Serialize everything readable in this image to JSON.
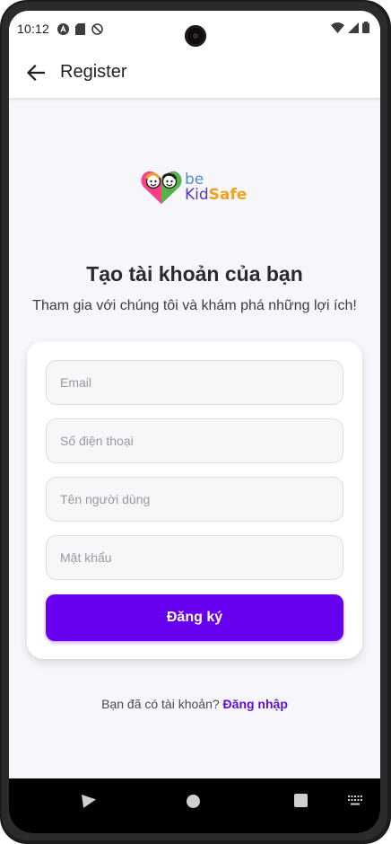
{
  "status_bar": {
    "time": "10:12",
    "left_icons": [
      "a-circle-icon",
      "sd-card-icon",
      "do-not-disturb-icon"
    ],
    "right_icons": [
      "wifi-icon",
      "signal-icon",
      "battery-icon"
    ]
  },
  "app_bar": {
    "title": "Register",
    "back_icon": "arrow-left-icon"
  },
  "logo": {
    "be": "be",
    "kid": "Kid",
    "safe": "Safe"
  },
  "heading": {
    "title": "Tạo tài khoản của bạn",
    "subtitle": "Tham gia với chúng tôi và khám phá những lợi ích!"
  },
  "form": {
    "email_placeholder": "Email",
    "phone_placeholder": "Số điện thoại",
    "username_placeholder": "Tên người dùng",
    "password_placeholder": "Mật khẩu",
    "submit_label": "Đăng ký"
  },
  "login_prompt": {
    "text": "Bạn đã có tài khoản?",
    "link": "Đăng nhập"
  },
  "colors": {
    "primary": "#6600ee",
    "link": "#5b0fd6",
    "background": "#f7f6fb"
  }
}
